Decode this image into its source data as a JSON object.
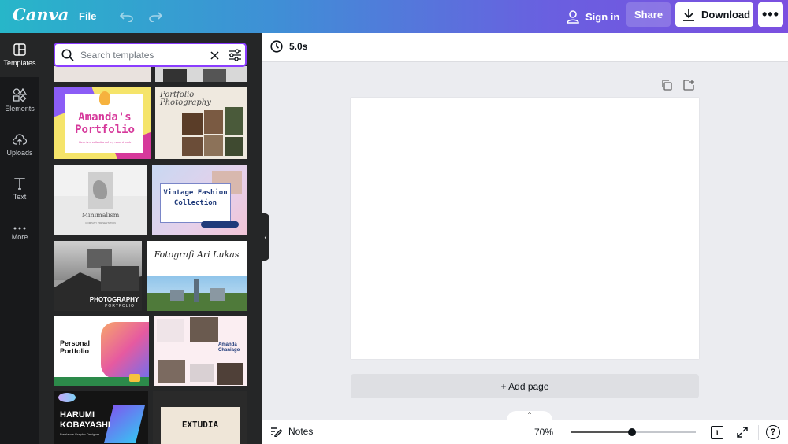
{
  "topbar": {
    "logo": "Canva",
    "file_label": "File",
    "signin_label": "Sign in",
    "share_label": "Share",
    "download_label": "Download",
    "more_label": "•••"
  },
  "leftnav": {
    "items": [
      {
        "label": "Templates",
        "icon": "templates-icon"
      },
      {
        "label": "Elements",
        "icon": "elements-icon"
      },
      {
        "label": "Uploads",
        "icon": "uploads-icon"
      },
      {
        "label": "Text",
        "icon": "text-icon"
      },
      {
        "label": "More",
        "icon": "more-icon"
      }
    ]
  },
  "search": {
    "placeholder": "Search templates"
  },
  "templates": [
    {
      "title": "Amanda's Portfolio",
      "subtitle": "Here is a collection of my recent work"
    },
    {
      "title": "Portfolio Photography"
    },
    {
      "title": "Minimalism",
      "subtitle": "COMPANY PRESENTATION"
    },
    {
      "title": "Vintage Fashion Collection"
    },
    {
      "title": "PHOTOGRAPHY",
      "subtitle": "PORTFOLIO"
    },
    {
      "title": "Fotografi Ari Lukas"
    },
    {
      "title": "Personal Portfolio"
    },
    {
      "title": "Amanda Chaniago"
    },
    {
      "title": "HARUMI KOBAYASHI",
      "subtitle": "Freelance Graphic Designer"
    },
    {
      "title": "EXTUDIA"
    }
  ],
  "editor": {
    "duration": "5.0s",
    "add_page_label": "+ Add page"
  },
  "footer": {
    "notes_label": "Notes",
    "zoom_label": "70%",
    "zoom_fraction": 0.49,
    "page_count": "1",
    "help_label": "?"
  }
}
